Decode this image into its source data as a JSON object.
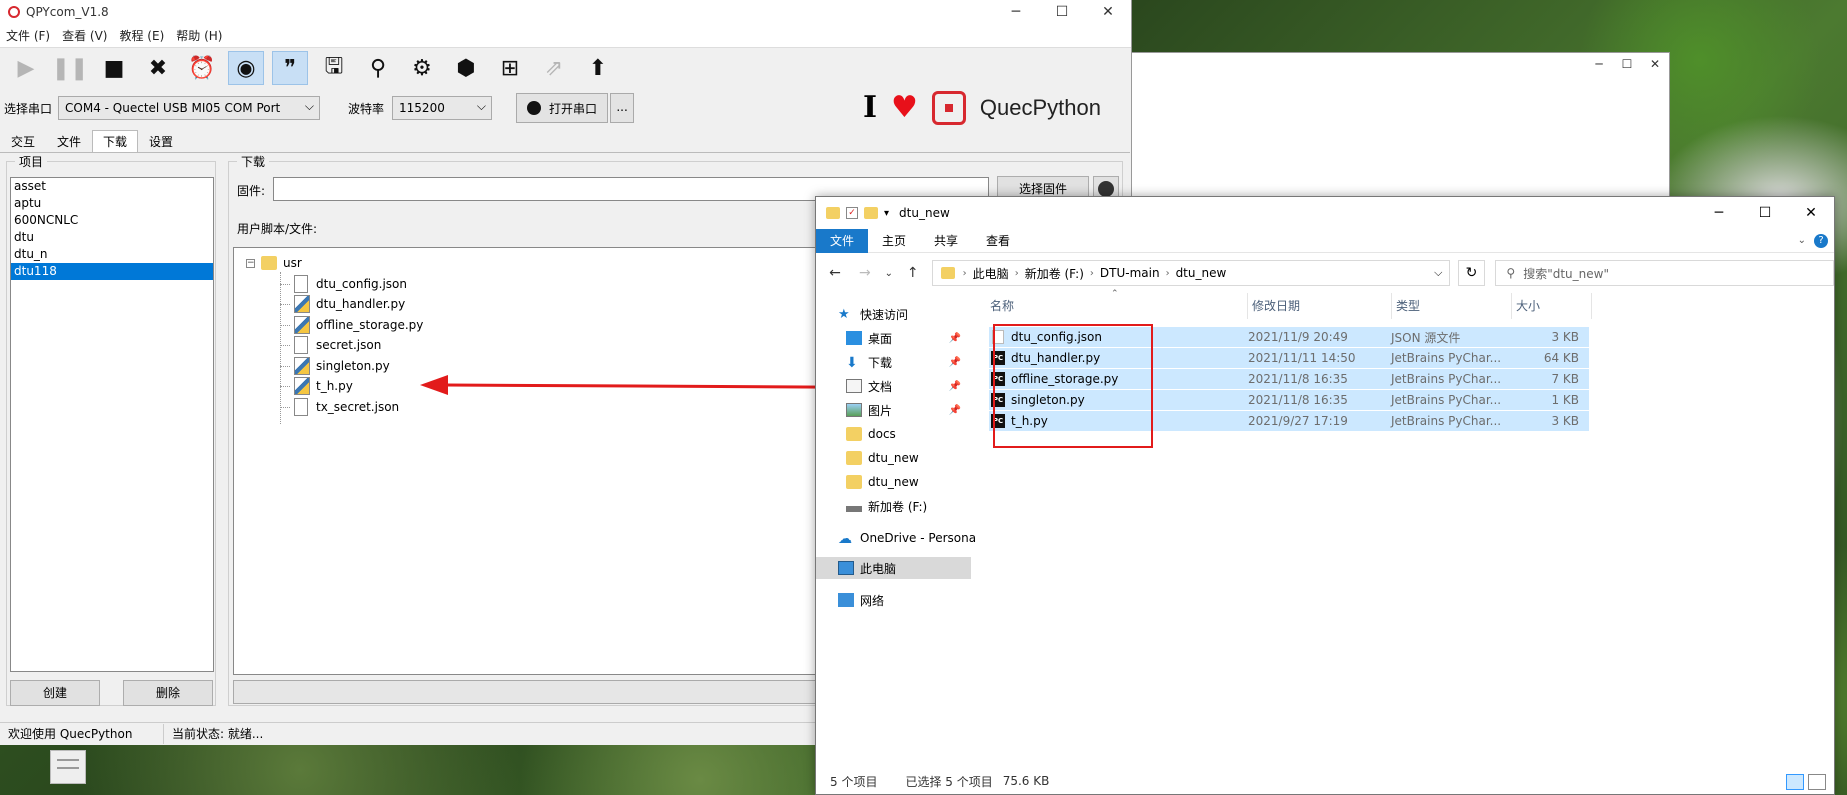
{
  "qpy": {
    "title": "QPYcom_V1.8",
    "menu": [
      "文件 (F)",
      "查看 (V)",
      "教程 (E)",
      "帮助 (H)"
    ],
    "caption": {
      "min": "─",
      "max": "☐",
      "close": "✕"
    },
    "port_label": "选择串口",
    "port_value": "COM4 - Quectel USB MI05 COM Port",
    "baud_label": "波特率",
    "baud_value": "115200",
    "open_port": "打开串口",
    "more": "...",
    "brand": "QuecPython",
    "tabs": [
      "交互",
      "文件",
      "下载",
      "设置"
    ],
    "project_group": "项目",
    "projects": [
      "asset",
      "aptu",
      "600NCNLC",
      "dtu",
      "dtu_n",
      "dtu118"
    ],
    "create_btn": "创建",
    "delete_btn": "删除",
    "download_group": "下载",
    "firmware_label": "固件:",
    "select_firmware": "选择固件",
    "user_files_label": "用户脚本/文件:",
    "tree_root": "usr",
    "tree_files": [
      "dtu_config.json",
      "dtu_handler.py",
      "offline_storage.py",
      "secret.json",
      "singleton.py",
      "t_h.py",
      "tx_secret.json"
    ],
    "status_left": "欢迎使用 QuecPython",
    "status_right": "当前状态: 就绪..."
  },
  "explorer": {
    "title": "dtu_new",
    "caption": {
      "min": "─",
      "max": "☐",
      "close": "✕"
    },
    "ribbon": [
      "文件",
      "主页",
      "共享",
      "查看"
    ],
    "breadcrumb": [
      "此电脑",
      "新加卷 (F:)",
      "DTU-main",
      "dtu_new"
    ],
    "search_placeholder": "搜索\"dtu_new\"",
    "nav": {
      "quick": "快速访问",
      "desktop": "桌面",
      "downloads": "下载",
      "documents": "文档",
      "pictures": "图片",
      "docs": "docs",
      "dtu_new_1": "dtu_new",
      "dtu_new_2": "dtu_new",
      "drive": "新加卷 (F:)",
      "onedrive": "OneDrive - Persona",
      "thispc": "此电脑",
      "network": "网络"
    },
    "columns": {
      "name": "名称",
      "date": "修改日期",
      "type": "类型",
      "size": "大小"
    },
    "files": [
      {
        "name": "dtu_config.json",
        "date": "2021/11/9 20:49",
        "type": "JSON 源文件",
        "size": "3 KB",
        "icon": "json"
      },
      {
        "name": "dtu_handler.py",
        "date": "2021/11/11 14:50",
        "type": "JetBrains PyChar...",
        "size": "64 KB",
        "icon": "pycharm"
      },
      {
        "name": "offline_storage.py",
        "date": "2021/11/8 16:35",
        "type": "JetBrains PyChar...",
        "size": "7 KB",
        "icon": "pycharm"
      },
      {
        "name": "singleton.py",
        "date": "2021/11/8 16:35",
        "type": "JetBrains PyChar...",
        "size": "1 KB",
        "icon": "pycharm"
      },
      {
        "name": "t_h.py",
        "date": "2021/9/27 17:19",
        "type": "JetBrains PyChar...",
        "size": "3 KB",
        "icon": "pycharm"
      }
    ],
    "status_count": "5 个项目",
    "status_selected": "已选择 5 个项目",
    "status_size": "75.6 KB"
  },
  "colors": {
    "accent": "#0078d7",
    "ribbon_file": "#1979ca",
    "selection": "#cce8ff",
    "annotation_red": "#e21b1b",
    "brand_red": "#d7282f"
  }
}
